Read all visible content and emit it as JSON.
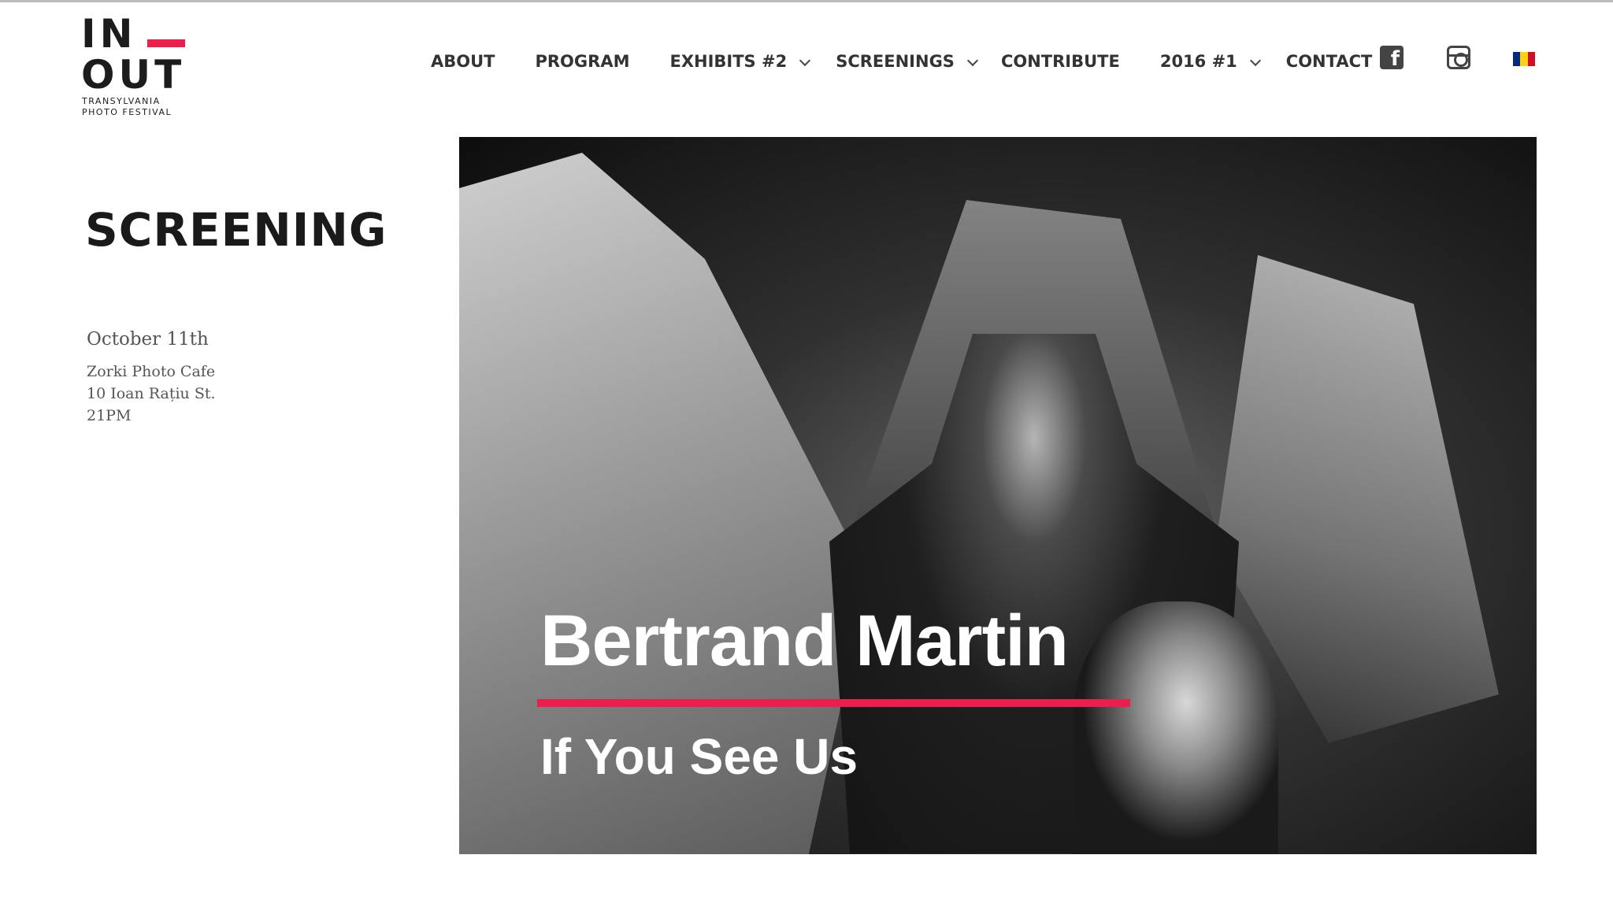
{
  "brand": {
    "line1": "IN",
    "line2": "OUT",
    "tagline1": "TRANSYLVANIA",
    "tagline2": "PHOTO FESTIVAL",
    "accent_color": "#e8204b"
  },
  "nav": {
    "items": [
      {
        "label": "ABOUT",
        "has_dropdown": false
      },
      {
        "label": "PROGRAM",
        "has_dropdown": false
      },
      {
        "label": "EXHIBITS #2",
        "has_dropdown": true
      },
      {
        "label": "SCREENINGS",
        "has_dropdown": true
      },
      {
        "label": "CONTRIBUTE",
        "has_dropdown": false
      },
      {
        "label": "2016 #1",
        "has_dropdown": true
      },
      {
        "label": "CONTACT",
        "has_dropdown": false
      }
    ],
    "social": [
      {
        "icon": "facebook-icon",
        "glyph": "f"
      },
      {
        "icon": "instagram-icon"
      },
      {
        "icon": "romanian-flag-icon",
        "colors": [
          "#002b7f",
          "#fcd116",
          "#ce1126"
        ]
      }
    ]
  },
  "page": {
    "title": "SCREENING",
    "date": "October 11th",
    "venue": "Zorki Photo Cafe",
    "address": "10 Ioan Rațiu St.",
    "time": "21PM"
  },
  "hero": {
    "name": "Bertrand Martin",
    "subtitle": "If You See Us"
  }
}
